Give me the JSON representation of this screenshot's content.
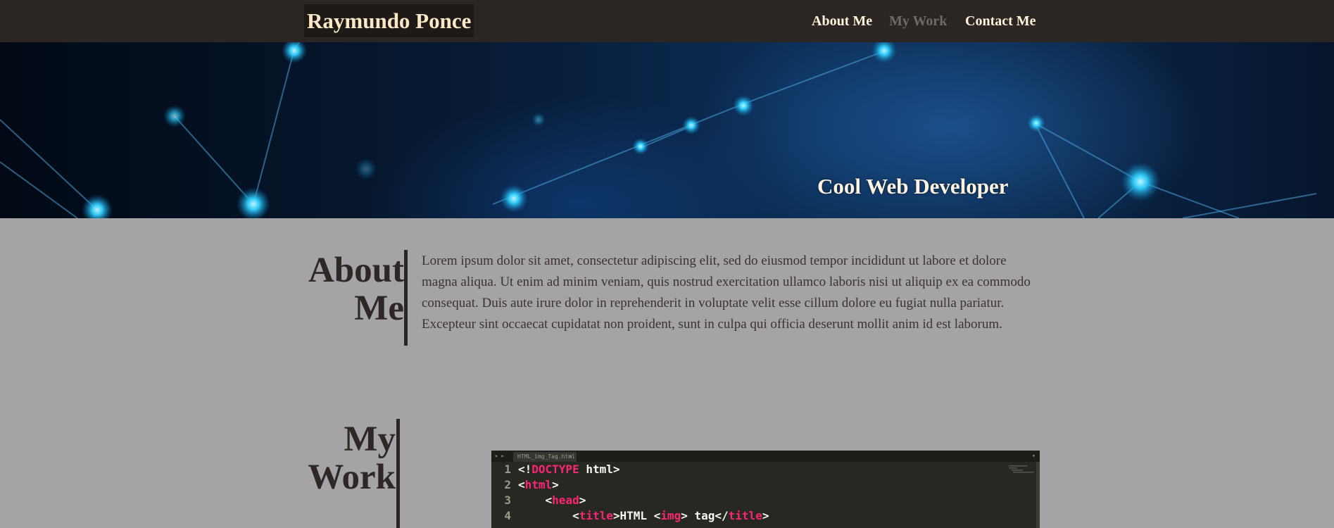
{
  "header": {
    "brand": "Raymundo Ponce",
    "nav": [
      {
        "label": "About Me",
        "active": false
      },
      {
        "label": "My Work",
        "active": true
      },
      {
        "label": "Contact Me",
        "active": false
      }
    ]
  },
  "hero": {
    "tagline": "Cool Web Developer"
  },
  "about": {
    "title_line1": "About",
    "title_line2": "Me",
    "body": "Lorem ipsum dolor sit amet, consectetur adipiscing elit, sed do eiusmod tempor incididunt ut labore et dolore magna aliqua. Ut enim ad minim veniam, quis nostrud exercitation ullamco laboris nisi ut aliquip ex ea commodo consequat. Duis aute irure dolor in reprehenderit in voluptate velit esse cillum dolore eu fugiat nulla pariatur. Excepteur sint occaecat cupidatat non proident, sunt in culpa qui officia deserunt mollit anim id est laborum."
  },
  "work": {
    "title_line1": "My",
    "title_line2": "Work",
    "code_preview": {
      "tab_label": "HTML_img_Tag.html",
      "tab_close": "×",
      "tabbar_left_glyph": "◂ ▸",
      "tabbar_right_glyph": "▾",
      "lines": [
        {
          "num": "1",
          "pre": "<!",
          "kw": "DOCTYPE",
          "post": " html>"
        },
        {
          "num": "2",
          "pre": "<",
          "kw": "html",
          "post": ">"
        },
        {
          "num": "3",
          "pre": "    <",
          "kw": "head",
          "post": ">"
        },
        {
          "num": "4",
          "pre": "        <",
          "kw": "title",
          "post": ">HTML <",
          "kw2": "img",
          "post2": "> tag</",
          "kw3": "title",
          "post3": ">"
        }
      ]
    }
  },
  "colors": {
    "header_bg": "#2b2523",
    "page_bg": "#a5a3a4",
    "brand_text": "#fbe8c6",
    "nav_active": "#6f6a68",
    "nav_default": "#fff4dc",
    "code_keyword": "#f92672"
  }
}
